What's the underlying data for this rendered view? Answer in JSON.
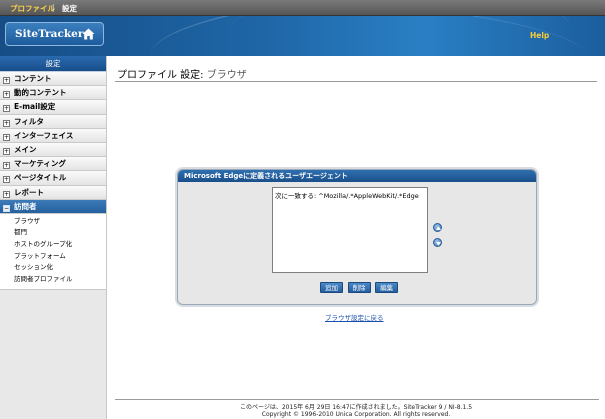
{
  "topbar": {
    "profile": "プロファイル",
    "separator": "|",
    "settings": "設定"
  },
  "header": {
    "logo": "SiteTracker",
    "help": "Help"
  },
  "sidebar": {
    "title": "設定",
    "items": [
      {
        "label": "コンテント",
        "toggle": "+"
      },
      {
        "label": "動的コンテント",
        "toggle": "+"
      },
      {
        "label": "E-mail設定",
        "toggle": "+"
      },
      {
        "label": "フィルタ",
        "toggle": "+"
      },
      {
        "label": "インターフェイス",
        "toggle": "+"
      },
      {
        "label": "メイン",
        "toggle": "+"
      },
      {
        "label": "マーケティング",
        "toggle": "+"
      },
      {
        "label": "ページタイトル",
        "toggle": "+"
      },
      {
        "label": "レポート",
        "toggle": "+"
      },
      {
        "label": "訪問者",
        "toggle": "−"
      }
    ],
    "subitems": [
      "ブラウザ",
      "都門",
      "ホストのグループ化",
      "プラットフォーム",
      "セッション化",
      "訪問者プロファイル"
    ]
  },
  "main": {
    "title": "プロファイル 設定:",
    "subtitle": "ブラウザ",
    "panel_title": "Microsoft Edgeに定義されるユーザエージェント",
    "list_item": "次に一致する: ^Mozilla/.*AppleWebKit/.*Edge",
    "buttons": {
      "add": "追加",
      "delete": "削除",
      "edit": "編集"
    },
    "back_link": "ブラウザ設定に戻る"
  },
  "footer": {
    "line1": "このページは、2015年 6月 29日 16:47に作成されました。SiteTracker 9 / NI-8.1.5",
    "line2": "Copyright © 1996-2010 Unica Corporation. All rights reserved."
  }
}
